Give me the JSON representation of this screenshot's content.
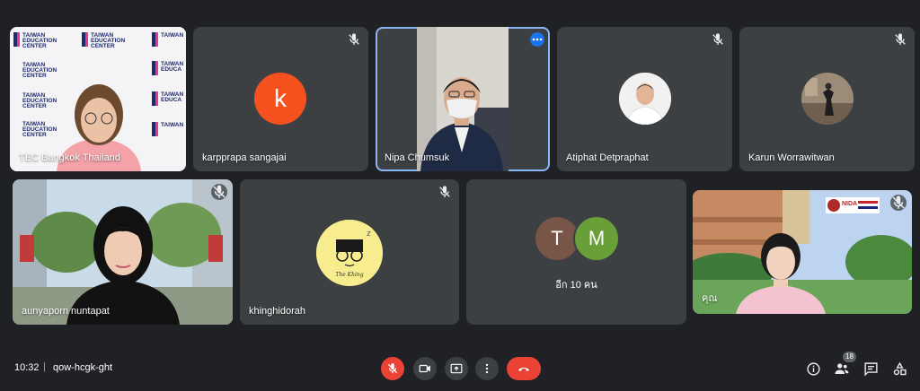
{
  "meeting": {
    "time": "10:32",
    "separator": "|",
    "code": "qow-hcgk-ght"
  },
  "participants_badge": "18",
  "tiles": {
    "bangkok": {
      "name": "TEC Bangkok Thailand",
      "banner_lines": [
        "TAIWAN",
        "EDUCATION",
        "CENTER",
        "Thailand"
      ]
    },
    "karpprapa": {
      "name": "karpprapa sangajai",
      "initial": "k"
    },
    "nipa": {
      "name": "Nipa Chumsuk"
    },
    "atiphat": {
      "name": "Atiphat Detpraphat"
    },
    "karun": {
      "name": "Karun Worrawitwan"
    },
    "aunyaporn": {
      "name": "aunyaporn nuntapat"
    },
    "khinghidorah": {
      "name": "khinghidorah",
      "avatar_text": "The Khing"
    },
    "others": {
      "label": "อีก 10 คน",
      "initials": [
        "T",
        "M"
      ]
    },
    "self": {
      "name": "คุณ",
      "sign_text": "NIDA"
    }
  },
  "colors": {
    "accent": "#8ab4f8",
    "red": "#ea4335",
    "tile": "#3c4043",
    "bg": "#202124"
  },
  "icons": [
    "mic-off-icon",
    "camera-icon",
    "present-icon",
    "more-vert-icon",
    "hangup-icon",
    "info-icon",
    "people-icon",
    "chat-icon",
    "activities-icon"
  ]
}
